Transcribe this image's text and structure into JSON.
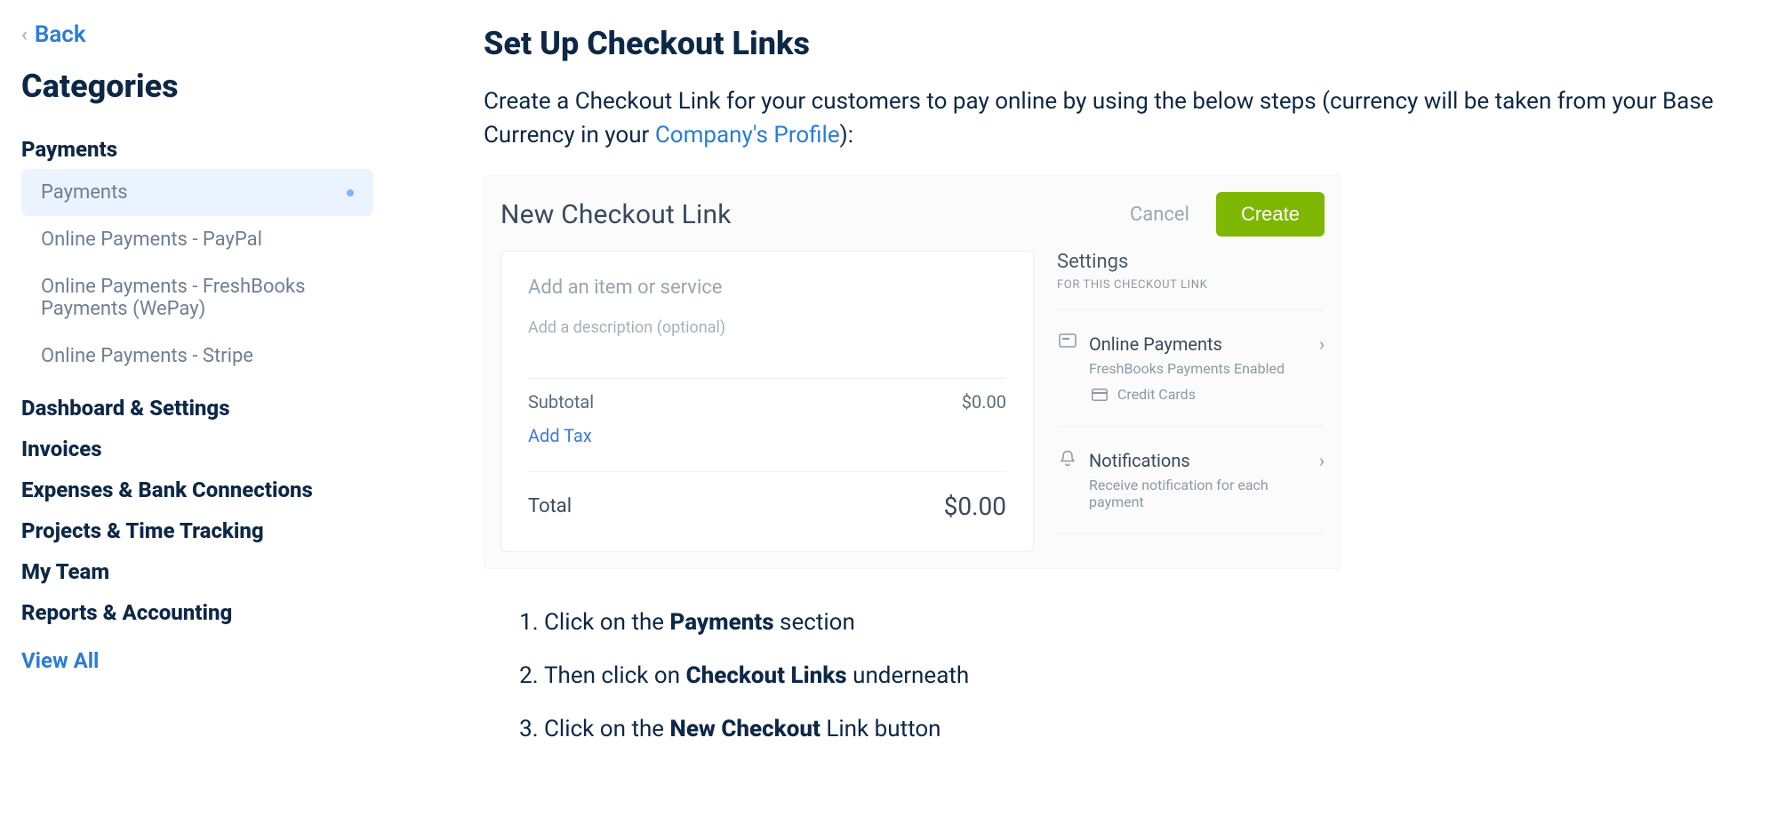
{
  "sidebar": {
    "back_label": "Back",
    "categories_title": "Categories",
    "view_all": "View All",
    "groups": [
      {
        "heading": "Payments",
        "items": [
          {
            "label": "Payments",
            "active": true
          },
          {
            "label": "Online Payments - PayPal",
            "active": false
          },
          {
            "label": "Online Payments - FreshBooks Payments (WePay)",
            "active": false
          },
          {
            "label": "Online Payments - Stripe",
            "active": false
          }
        ]
      },
      {
        "heading": "Dashboard & Settings",
        "items": []
      },
      {
        "heading": "Invoices",
        "items": []
      },
      {
        "heading": "Expenses & Bank Connections",
        "items": []
      },
      {
        "heading": "Projects & Time Tracking",
        "items": []
      },
      {
        "heading": "My Team",
        "items": []
      },
      {
        "heading": "Reports & Accounting",
        "items": []
      }
    ]
  },
  "main": {
    "title": "Set Up Checkout Links",
    "intro_pre": "Create a Checkout Link for your customers to pay online by using the below steps (currency will be taken from your Base Currency in your ",
    "intro_link": "Company's Profile",
    "intro_post": "):",
    "mock": {
      "title": "New Checkout Link",
      "cancel": "Cancel",
      "create": "Create",
      "item_placeholder": "Add an item or service",
      "desc_placeholder": "Add a description (optional)",
      "subtotal_label": "Subtotal",
      "subtotal_amount": "$0.00",
      "add_tax": "Add Tax",
      "total_label": "Total",
      "total_amount": "$0.00",
      "settings_title": "Settings",
      "settings_sub": "FOR THIS CHECKOUT LINK",
      "online_payments": {
        "name": "Online Payments",
        "meta1": "FreshBooks Payments Enabled",
        "meta2": "Credit Cards"
      },
      "notifications": {
        "name": "Notifications",
        "meta": "Receive notification for each payment"
      }
    },
    "steps": [
      {
        "pre": "Click on the ",
        "bold": "Payments",
        "post": " section"
      },
      {
        "pre": "Then click on ",
        "bold": "Checkout Links",
        "post": " underneath"
      },
      {
        "pre": "Click on the ",
        "bold": "New Checkout",
        "post": " Link button"
      }
    ]
  }
}
